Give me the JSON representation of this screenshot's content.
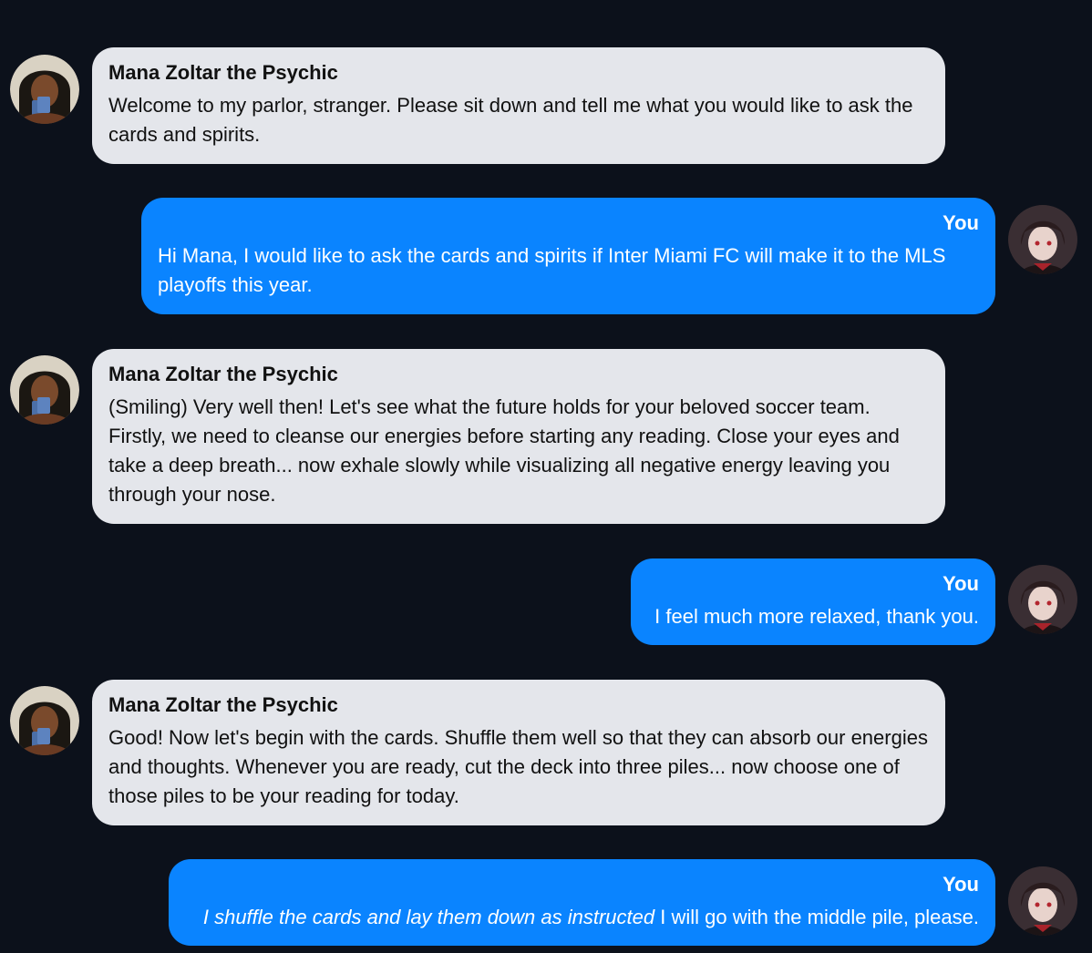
{
  "conversation": {
    "messages": [
      {
        "role": "bot",
        "sender": "Mana Zoltar the Psychic",
        "text": "Welcome to my parlor, stranger. Please sit down and tell me what you would like to ask the cards and spirits."
      },
      {
        "role": "user",
        "sender": "You",
        "text": "Hi Mana, I would like to ask the cards and spirits if Inter Miami FC will make it to the MLS playoffs this year."
      },
      {
        "role": "bot",
        "sender": "Mana Zoltar the Psychic",
        "text": "(Smiling) Very well then! Let's see what the future holds for your beloved soccer team. Firstly, we need to cleanse our energies before starting any reading. Close your eyes and take a deep breath... now exhale slowly while visualizing all negative energy leaving you through your nose."
      },
      {
        "role": "user",
        "sender": "You",
        "text": "I feel much more relaxed, thank you."
      },
      {
        "role": "bot",
        "sender": "Mana Zoltar the Psychic",
        "text": "Good! Now let's begin with the cards. Shuffle them well so that they can absorb our energies and thoughts. Whenever you are ready, cut the deck into three piles... now choose one of those piles to be your reading for today."
      },
      {
        "role": "user",
        "sender": "You",
        "text_italic": "I shuffle the cards and lay them down as instructed",
        "text": " I will go with the middle pile, please."
      }
    ]
  },
  "colors": {
    "background": "#0c111b",
    "bot_bubble": "#e4e6eb",
    "user_bubble": "#0a84ff"
  },
  "icons": {
    "bot_avatar": "psychic-avatar",
    "user_avatar": "user-avatar"
  }
}
